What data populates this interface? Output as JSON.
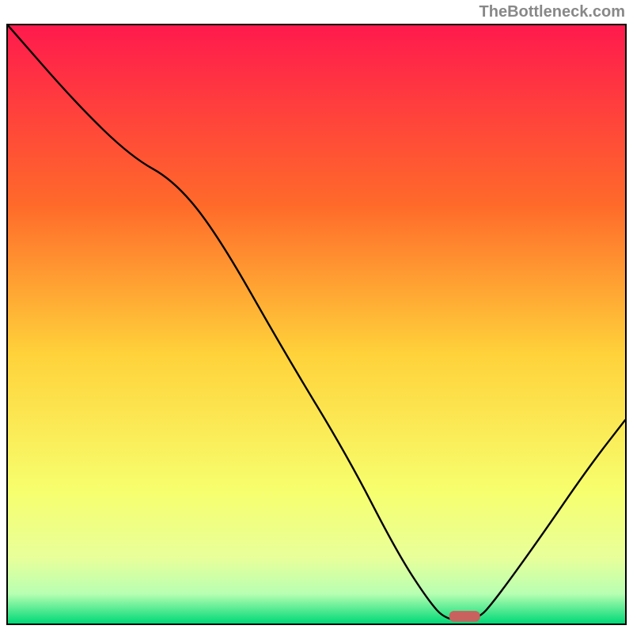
{
  "watermark": "TheBottleneck.com",
  "colors": {
    "gradient_top": "#ff1a4d",
    "gradient_mid1": "#ff8a2a",
    "gradient_mid2": "#ffe83a",
    "gradient_mid3": "#f7ff6e",
    "gradient_band": "#c9ffb2",
    "gradient_bottom": "#00d977",
    "curve": "#000000",
    "marker": "#c9615f"
  },
  "chart_data": {
    "type": "line",
    "title": "",
    "xlabel": "",
    "ylabel": "",
    "xlim": [
      0,
      100
    ],
    "ylim": [
      0,
      100
    ],
    "curve_points": [
      {
        "x": 0,
        "y": 100
      },
      {
        "x": 11,
        "y": 87
      },
      {
        "x": 20,
        "y": 78
      },
      {
        "x": 27,
        "y": 74
      },
      {
        "x": 34,
        "y": 65
      },
      {
        "x": 45,
        "y": 45
      },
      {
        "x": 55,
        "y": 28
      },
      {
        "x": 63,
        "y": 12
      },
      {
        "x": 68,
        "y": 4
      },
      {
        "x": 71,
        "y": 0.5
      },
      {
        "x": 76,
        "y": 0.5
      },
      {
        "x": 79,
        "y": 4
      },
      {
        "x": 86,
        "y": 14
      },
      {
        "x": 94,
        "y": 26
      },
      {
        "x": 100,
        "y": 34
      }
    ],
    "marker": {
      "x": 74,
      "y": 1.2,
      "w": 5,
      "h": 1.8
    },
    "gradient_stops": [
      {
        "offset": 0.0,
        "color": "#ff1a4d"
      },
      {
        "offset": 0.3,
        "color": "#ff6a2a"
      },
      {
        "offset": 0.55,
        "color": "#ffd23a"
      },
      {
        "offset": 0.78,
        "color": "#f7ff6e"
      },
      {
        "offset": 0.89,
        "color": "#e8ff9a"
      },
      {
        "offset": 0.95,
        "color": "#b8ffb2"
      },
      {
        "offset": 1.0,
        "color": "#00d977"
      }
    ]
  }
}
